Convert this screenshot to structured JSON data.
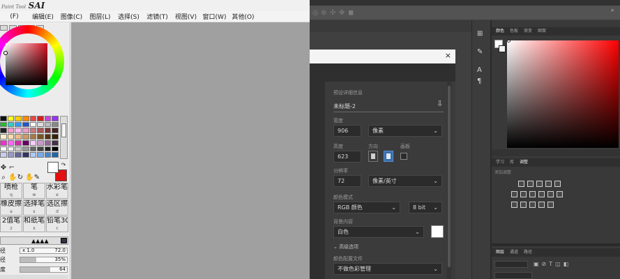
{
  "sai": {
    "logo_small": "Paint Tool",
    "logo_big": "SAI",
    "menu": [
      "(F)",
      "编辑(E)",
      "图像(C)",
      "图层(L)",
      "选择(S)",
      "滤镜(T)",
      "视图(V)",
      "窗口(W)",
      "其他(O)"
    ],
    "tools": [
      {
        "label": "喷枪",
        "key": "q"
      },
      {
        "label": "笔",
        "key": "w"
      },
      {
        "label": "水彩笔",
        "key": "e"
      },
      {
        "label": "橡皮擦",
        "key": "a"
      },
      {
        "label": "选择笔",
        "key": "s"
      },
      {
        "label": "选区擦",
        "key": "d"
      },
      {
        "label": "2值笔",
        "key": "z"
      },
      {
        "label": "和纸笔",
        "key": "x"
      },
      {
        "label": "铅笔30",
        "key": "c"
      }
    ],
    "props": [
      {
        "label": "径",
        "value": "x 1.0",
        "extra": "72.0"
      },
      {
        "label": "径",
        "value": "35%",
        "fill": 0.35
      },
      {
        "label": "度",
        "value": "64",
        "fill": 0.64
      }
    ],
    "colors": {
      "main": "#ffffff",
      "sub": "#e21010",
      "canvas": "#a0a0a0"
    }
  },
  "ps": {
    "panel_tabs_top": [
      "颜色",
      "色板",
      "渐变",
      "图案"
    ],
    "panel_tabs_mid": [
      "学习",
      "库",
      "调整"
    ],
    "panel_mid_sub": "添加调整",
    "panel_tabs_bot": [
      "图层",
      "通道",
      "路径"
    ],
    "dialog": {
      "preset_label": "预设详细信息",
      "preset_name": "未标题-2",
      "width_label": "宽度",
      "width_value": "906",
      "width_unit": "像素",
      "height_label": "高度",
      "height_value": "623",
      "orient_label": "方向",
      "artboard_label": "画板",
      "resolution_label": "分辨率",
      "resolution_value": "72",
      "resolution_unit": "像素/英寸",
      "colormode_label": "颜色模式",
      "colormode_value": "RGB 颜色",
      "bitdepth_value": "8 bit",
      "bg_label": "背景内容",
      "bg_value": "白色",
      "advanced_label": "高级选项",
      "profile_label": "颜色配置文件",
      "profile_value": "不做色彩管理",
      "close_glyph": "×"
    }
  }
}
